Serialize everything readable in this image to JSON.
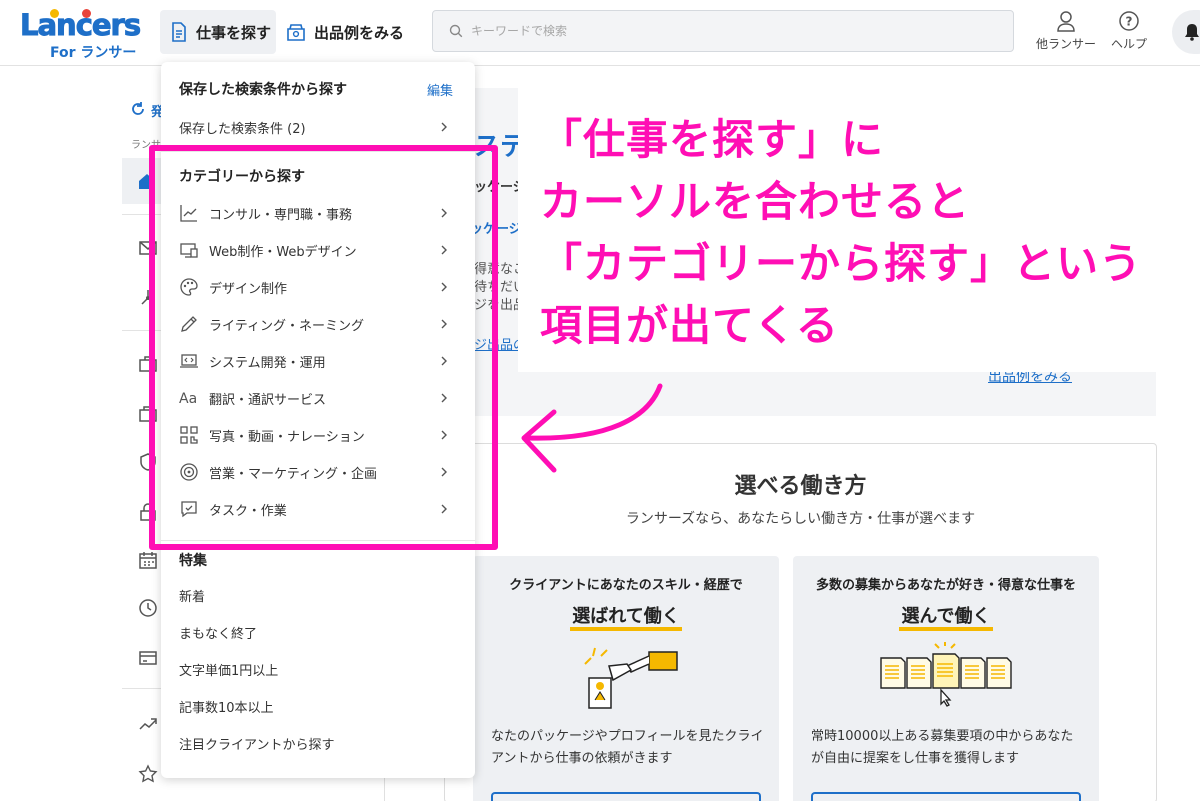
{
  "header": {
    "logo_text": "Lancers",
    "logo_sub": "For ランサー",
    "nav_find": "仕事を探す",
    "nav_examples": "出品例をみる",
    "search_placeholder": "キーワードで検索",
    "other_lancer": "他ランサー",
    "help": "ヘルプ"
  },
  "sidebar": {
    "peek1": "発",
    "peek2": "ランサ"
  },
  "main": {
    "peek_title": "ステ",
    "peek_lines": [
      "ッケージ",
      "ッケージ",
      "得意なこ",
      "待ちだい",
      "ジを出品"
    ],
    "peek_link_small": "ジ出品の",
    "examples_link": "出品例をみる",
    "work_title": "選べる働き方",
    "work_subtitle": "ランサーズなら、あなたらしい働き方・仕事が選べます",
    "modes": [
      {
        "top": "クライアントにあなたのスキル・経歴で",
        "head": "選ばれて働く",
        "desc": "なたのパッケージやプロフィールを見たクライアントから仕事の依頼がきます"
      },
      {
        "top": "多数の募集からあなたが好き・得意な仕事を",
        "head": "選んで働く",
        "desc": "常時10000以上ある募集要項の中からあなたが自由に提案をし仕事を獲得します"
      }
    ]
  },
  "dropdown": {
    "saved_heading": "保存した検索条件から探す",
    "edit": "編集",
    "saved_item": "保存した検索条件 (2)",
    "category_heading": "カテゴリーから探す",
    "categories": [
      {
        "label": "コンサル・専門職・事務",
        "icon": "chart-line-icon"
      },
      {
        "label": "Web制作・Webデザイン",
        "icon": "monitor-icon"
      },
      {
        "label": "デザイン制作",
        "icon": "palette-icon"
      },
      {
        "label": "ライティング・ネーミング",
        "icon": "pen-icon"
      },
      {
        "label": "システム開発・運用",
        "icon": "laptop-code-icon"
      },
      {
        "label": "翻訳・通訳サービス",
        "icon": "translate-icon"
      },
      {
        "label": "写真・動画・ナレーション",
        "icon": "media-icon"
      },
      {
        "label": "営業・マーケティング・企画",
        "icon": "target-icon"
      },
      {
        "label": "タスク・作業",
        "icon": "task-icon"
      }
    ],
    "feature_heading": "特集",
    "features": [
      "新着",
      "まもなく終了",
      "文字単価1円以上",
      "記事数10本以上",
      "注目クライアントから探す"
    ]
  },
  "annotation": {
    "lines": [
      "「仕事を探す」に",
      "カーソルを合わせると",
      "「カテゴリーから探す」という",
      "項目が出てくる"
    ],
    "color": "#ff0eb4"
  }
}
